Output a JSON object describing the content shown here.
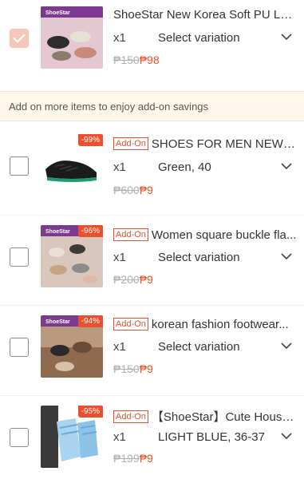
{
  "top_item": {
    "title": "ShoeStar New Korea Soft PU Lea...",
    "qty": "x1",
    "variation": "Select variation",
    "old_price": "₱150",
    "new_price": "₱98",
    "thumb_label": "ShoeStar"
  },
  "banner": {
    "text": "Add on more items to enjoy add-on savings"
  },
  "addon_tag": "Add-On",
  "items": [
    {
      "discount": "-99%",
      "title": "SHOES FOR MEN NEW K...",
      "qty": "x1",
      "variation": "Green, 40",
      "old_price": "₱600",
      "new_price": "₱9"
    },
    {
      "discount": "-96%",
      "title": "Women square buckle fla...",
      "qty": "x1",
      "variation": "Select variation",
      "old_price": "₱200",
      "new_price": "₱9",
      "thumb_label": "ShoeStar"
    },
    {
      "discount": "-94%",
      "title": "korean fashion footwear...",
      "qty": "x1",
      "variation": "Select variation",
      "old_price": "₱150",
      "new_price": "₱9",
      "thumb_label": "ShoeStar"
    },
    {
      "discount": "-95%",
      "title": "【ShoeStar】Cute House...",
      "qty": "x1",
      "variation": "LIGHT BLUE, 36-37",
      "old_price": "₱199",
      "new_price": "₱9"
    }
  ],
  "colors": {
    "accent": "#e9502d",
    "banner_bg": "#fff8ea"
  },
  "icons": {
    "chevron": "chevron-down-icon",
    "checkbox": "checkbox"
  }
}
